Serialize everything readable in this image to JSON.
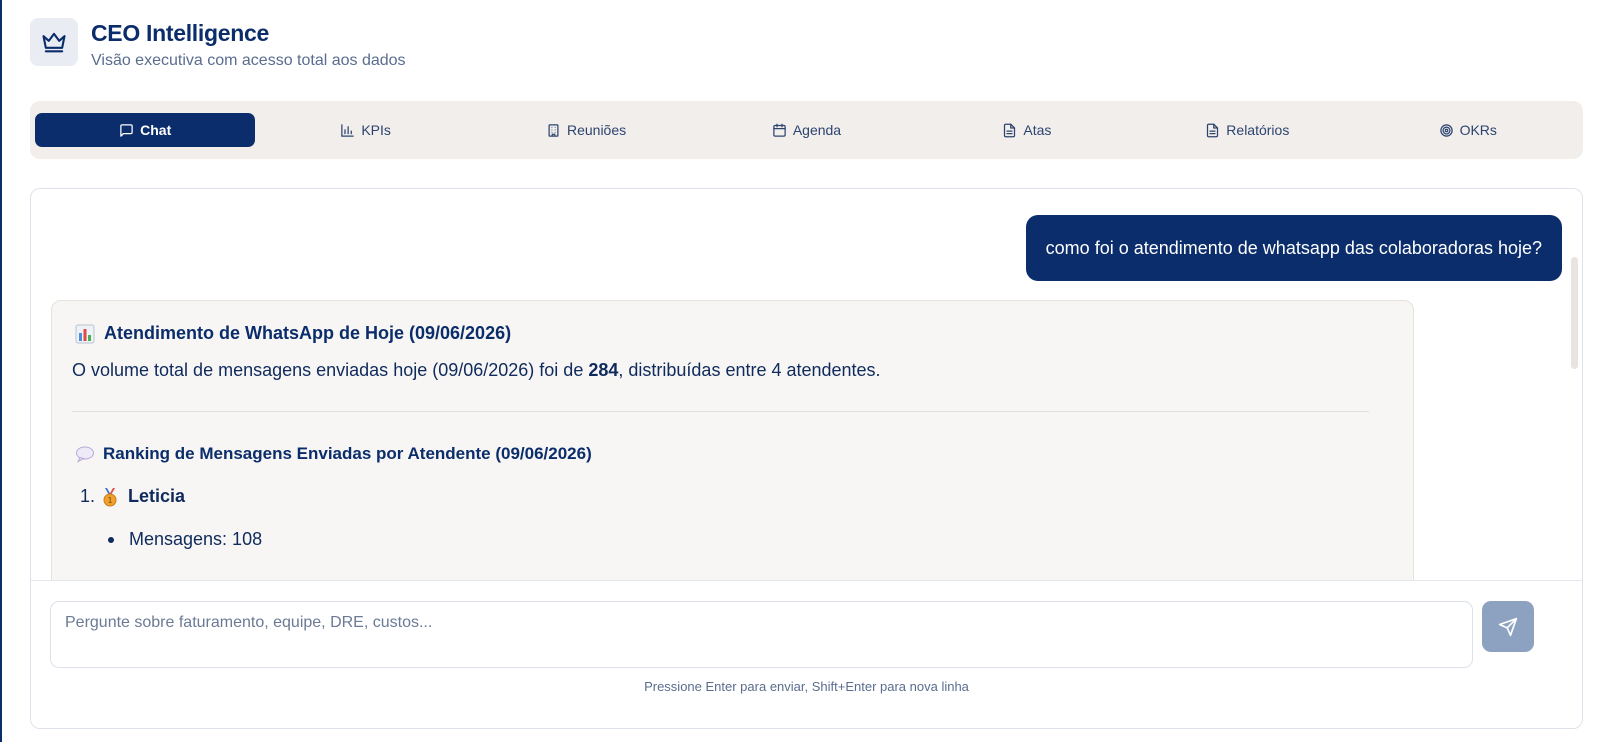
{
  "app": {
    "title": "CEO Intelligence",
    "subtitle": "Visão executiva com acesso total aos dados",
    "logo_icon": "crown-icon"
  },
  "tabs": [
    {
      "label": "Chat",
      "icon": "message-square-icon",
      "active": true
    },
    {
      "label": "KPIs",
      "icon": "bar-chart-icon",
      "active": false
    },
    {
      "label": "Reuniões",
      "icon": "building-icon",
      "active": false
    },
    {
      "label": "Agenda",
      "icon": "calendar-icon",
      "active": false
    },
    {
      "label": "Atas",
      "icon": "file-text-icon",
      "active": false
    },
    {
      "label": "Relatórios",
      "icon": "file-text-icon",
      "active": false
    },
    {
      "label": "OKRs",
      "icon": "target-icon",
      "active": false
    }
  ],
  "chat": {
    "user_message": "como foi o atendimento de whatsapp das colaboradoras hoje?",
    "response": {
      "title": "Atendimento de WhatsApp de Hoje (09/06/2026)",
      "summary_prefix": "O volume total de mensagens enviadas hoje (09/06/2026) foi de ",
      "summary_total": "284",
      "summary_suffix": ", distribuídas entre 4 atendentes.",
      "ranking_title": "Ranking de Mensagens Enviadas por Atendente (09/06/2026)",
      "ranking": [
        {
          "position": "1.",
          "name": "Leticia",
          "detail": "Mensagens: 108"
        }
      ]
    }
  },
  "input": {
    "placeholder": "Pergunte sobre faturamento, equipe, DRE, custos...",
    "value": "",
    "hint": "Pressione Enter para enviar, Shift+Enter para nova linha"
  },
  "colors": {
    "brand": "#0b2d6b",
    "tab_bar_bg": "#f1eeeb",
    "send_button": "#8da2c1"
  }
}
